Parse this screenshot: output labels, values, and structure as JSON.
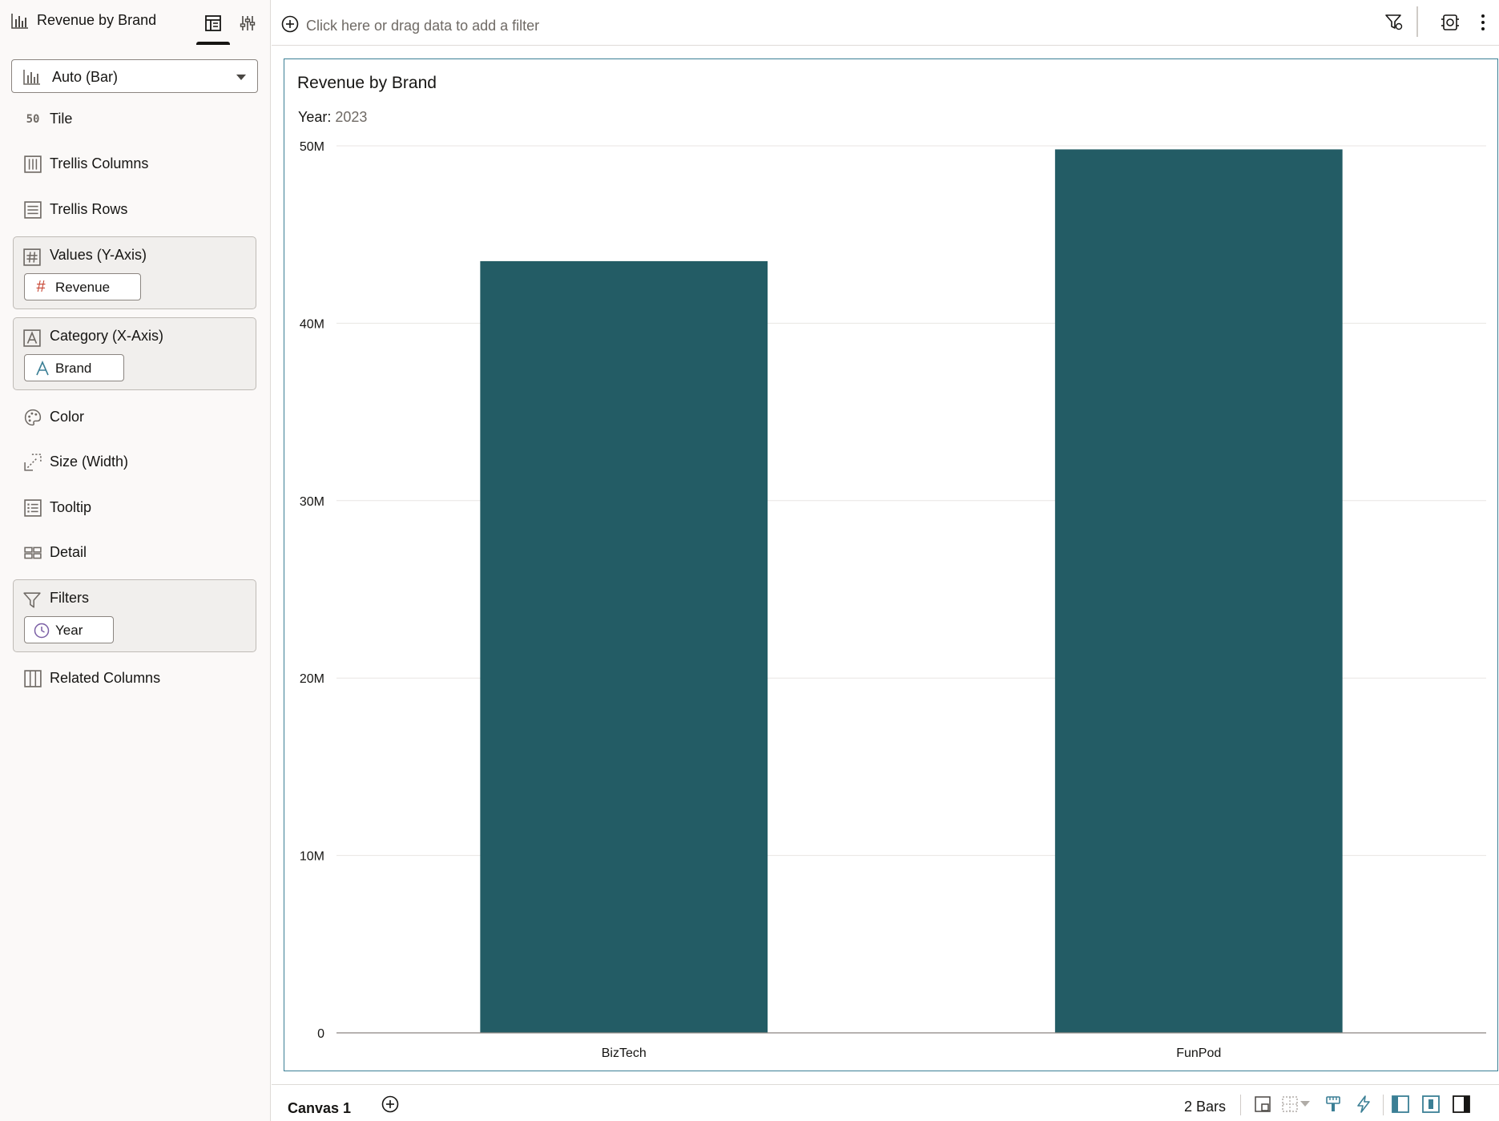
{
  "panel": {
    "title": "Revenue by Brand",
    "tabs": [
      {
        "name": "grammar",
        "icon": "grammar-panel-icon"
      },
      {
        "name": "properties",
        "icon": "properties-sliders-icon"
      }
    ],
    "viz_type": "Auto (Bar)",
    "sections": {
      "tile": "Tile",
      "trellis_columns": "Trellis Columns",
      "trellis_rows": "Trellis Rows",
      "values": {
        "label": "Values (Y-Axis)",
        "pill": "Revenue",
        "pill_icon": "measure-hash-icon",
        "pill_icon_color": "#c74634"
      },
      "category": {
        "label": "Category (X-Axis)",
        "pill": "Brand",
        "pill_icon": "attribute-a-icon",
        "pill_icon_color": "#3b7f95"
      },
      "color": "Color",
      "size": "Size (Width)",
      "tooltip": "Tooltip",
      "detail": "Detail",
      "filters": {
        "label": "Filters",
        "pill": "Year",
        "pill_icon": "time-clock-icon",
        "pill_icon_color": "#7b5fa5"
      },
      "related_columns": "Related Columns"
    }
  },
  "filter_bar": {
    "placeholder": "Click here or drag data to add a filter"
  },
  "viz": {
    "title": "Revenue by Brand",
    "filter_label": "Year:",
    "filter_value": "2023"
  },
  "chart_data": {
    "type": "bar",
    "title": "Revenue by Brand",
    "categories": [
      "BizTech",
      "FunPod"
    ],
    "values": [
      43500000,
      49800000
    ],
    "ylim": [
      0,
      50000000
    ],
    "yticks": [
      {
        "value": 0,
        "label": "0"
      },
      {
        "value": 10000000,
        "label": "10M"
      },
      {
        "value": 20000000,
        "label": "20M"
      },
      {
        "value": 30000000,
        "label": "30M"
      },
      {
        "value": 40000000,
        "label": "40M"
      },
      {
        "value": 50000000,
        "label": "50M"
      }
    ],
    "grid": true,
    "bar_color": "#235c65"
  },
  "bottom_bar": {
    "canvas_tab": "Canvas 1",
    "status": "2 Bars"
  },
  "colors": {
    "accent": "#3b7f95",
    "bar": "#235c65"
  }
}
